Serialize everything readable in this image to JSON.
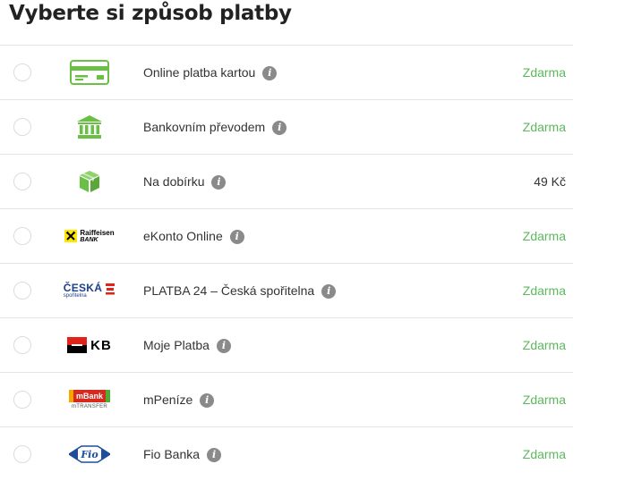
{
  "page": {
    "title": "Vyberte si způsob platby"
  },
  "methods": [
    {
      "label": "Online platba kartou",
      "price": "Zdarma",
      "price_color": "#5cb85c",
      "icon": "credit-card-icon"
    },
    {
      "label": "Bankovním převodem",
      "price": "Zdarma",
      "price_color": "#5cb85c",
      "icon": "bank-building-icon"
    },
    {
      "label": "Na dobírku",
      "price": "49 Kč",
      "price_color": "#333333",
      "icon": "package-box-icon"
    },
    {
      "label": "eKonto Online",
      "price": "Zdarma",
      "price_color": "#5cb85c",
      "icon": "raiffeisen-bank-logo",
      "logo_text": [
        "Raiffeisen",
        "BANK"
      ]
    },
    {
      "label": "PLATBA 24 – Česká spořitelna",
      "price": "Zdarma",
      "price_color": "#5cb85c",
      "icon": "ceska-sporitelna-logo",
      "logo_text": [
        "ČESKÁ",
        "spořitelna"
      ]
    },
    {
      "label": "Moje Platba",
      "price": "Zdarma",
      "price_color": "#5cb85c",
      "icon": "komercni-banka-logo",
      "logo_text": [
        "KB"
      ]
    },
    {
      "label": "mPeníze",
      "price": "Zdarma",
      "price_color": "#5cb85c",
      "icon": "mbank-logo",
      "logo_text": [
        "mBank",
        "mTRANSFER"
      ]
    },
    {
      "label": "Fio Banka",
      "price": "Zdarma",
      "price_color": "#5cb85c",
      "icon": "fio-banka-logo",
      "logo_text": [
        "Fio"
      ]
    }
  ],
  "info_glyph": "i",
  "colors": {
    "accent_green": "#5cb85c",
    "icon_green": "#6abf45",
    "divider": "#e4e4e4",
    "info_gray": "#8a8a8a"
  }
}
